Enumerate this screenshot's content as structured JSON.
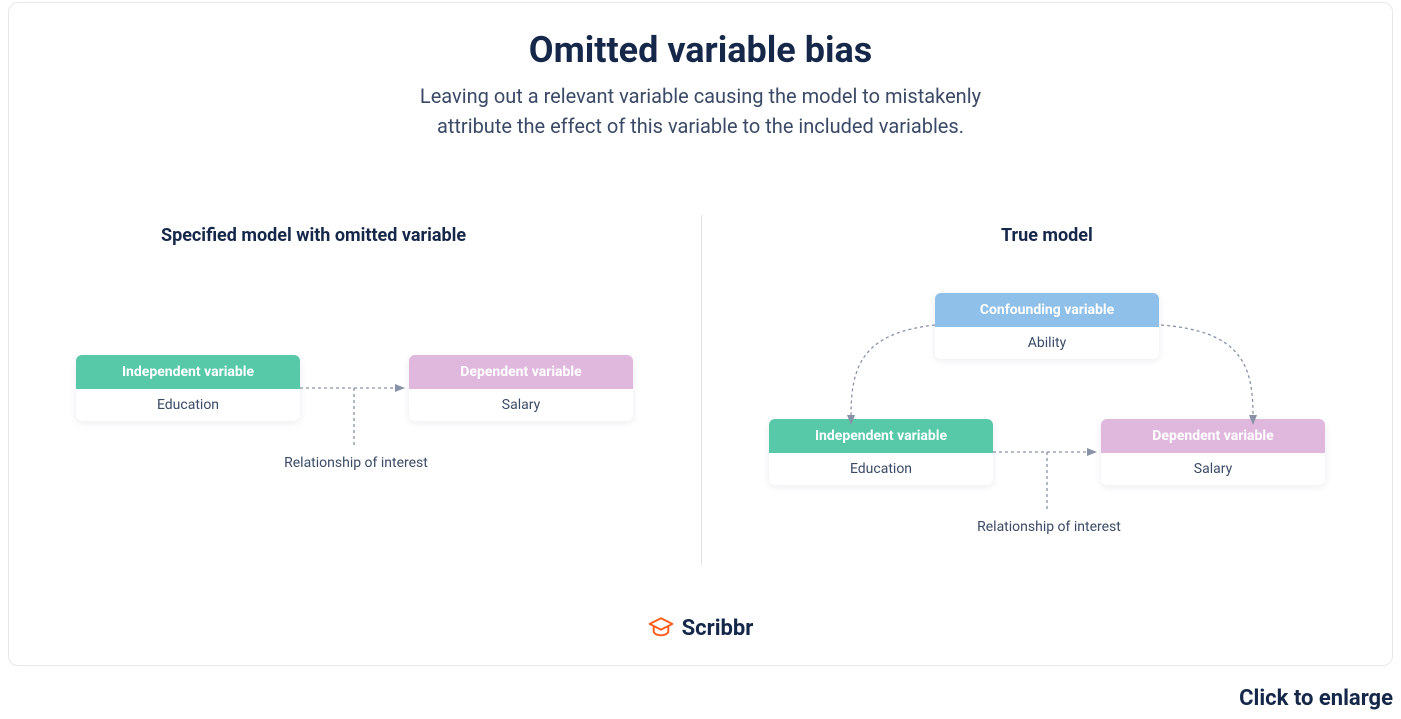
{
  "title": "Omitted variable bias",
  "subtitle_line1": "Leaving out a relevant variable causing the model to mistakenly",
  "subtitle_line2": "attribute the effect of this variable to the included variables.",
  "left": {
    "heading": "Specified model with omitted variable",
    "independent_head": "Independent variable",
    "independent_body": "Education",
    "dependent_head": "Dependent variable",
    "dependent_body": "Salary",
    "relationship": "Relationship of interest"
  },
  "right": {
    "heading": "True model",
    "confounding_head": "Confounding variable",
    "confounding_body": "Ability",
    "independent_head": "Independent variable",
    "independent_body": "Education",
    "dependent_head": "Dependent variable",
    "dependent_body": "Salary",
    "relationship": "Relationship of interest"
  },
  "brand": "Scribbr",
  "enlarge": "Click to enlarge",
  "colors": {
    "independent": "#57c9a8",
    "dependent": "#e0b8de",
    "confounding": "#8fc0e9",
    "arrow": "#8893a8"
  }
}
